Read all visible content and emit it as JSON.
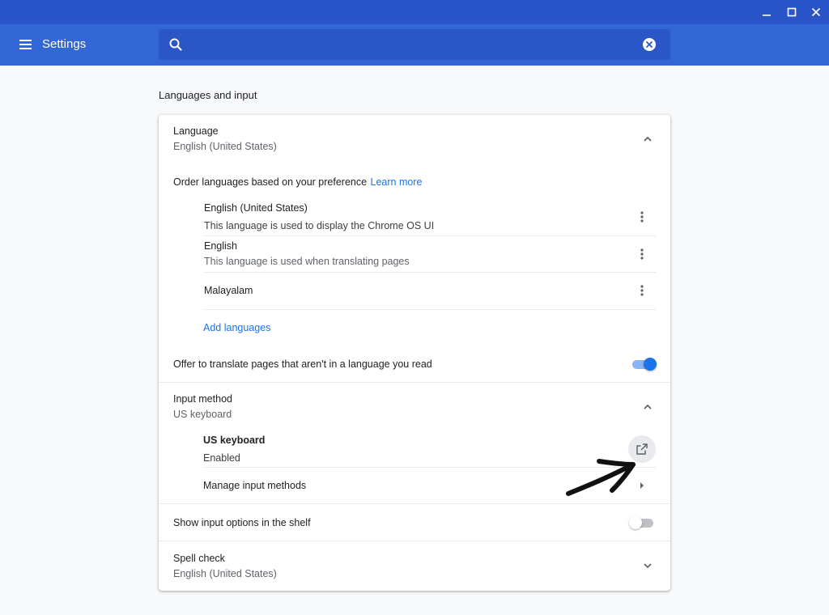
{
  "app": {
    "title": "Settings"
  },
  "search": {
    "value": "",
    "placeholder": ""
  },
  "section": {
    "title": "Languages and input"
  },
  "language": {
    "title": "Language",
    "subtitle": "English (United States)",
    "order_text": "Order languages based on your preference",
    "learn_more": "Learn more",
    "items": [
      {
        "name": "English (United States)",
        "description": "This language is used to display the Chrome OS UI"
      },
      {
        "name": "English",
        "description": "This language is used when translating pages"
      },
      {
        "name": "Malayalam",
        "description": ""
      }
    ],
    "add_languages": "Add languages",
    "translate_offer": {
      "label": "Offer to translate pages that aren't in a language you read",
      "enabled": true
    }
  },
  "input_method": {
    "title": "Input method",
    "subtitle": "US keyboard",
    "current": {
      "name": "US keyboard",
      "status": "Enabled"
    },
    "manage": "Manage input methods",
    "shelf_option": {
      "label": "Show input options in the shelf",
      "enabled": false
    }
  },
  "spell_check": {
    "title": "Spell check",
    "subtitle": "English (United States)"
  },
  "colors": {
    "accent": "#1a73e8",
    "titlebar": "#2a55c9",
    "toolbar": "#3367d6"
  }
}
